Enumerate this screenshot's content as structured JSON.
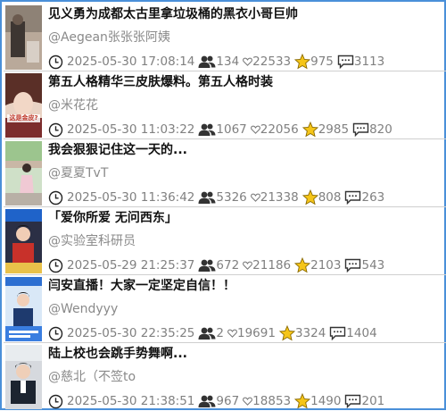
{
  "feed": {
    "items": [
      {
        "title": "见义勇为成都太古里拿垃圾桶的黑衣小哥巨帅",
        "author": "@Aegean张张张阿姨",
        "time": "2025-05-30 17:08:14",
        "viewers": "134",
        "likes": "22533",
        "stars": "975",
        "comments": "3113",
        "thumb_overlay": ""
      },
      {
        "title": "第五人格精华三皮肤爆料。第五人格时装",
        "author": "@米花花",
        "time": "2025-05-30 11:03:22",
        "viewers": "1067",
        "likes": "22056",
        "stars": "2985",
        "comments": "820",
        "thumb_overlay": "这是金皮?"
      },
      {
        "title": "我会狠狠记住这一天的...",
        "author": "@夏夏TvT",
        "time": "2025-05-30 11:36:42",
        "viewers": "5326",
        "likes": "21338",
        "stars": "808",
        "comments": "263",
        "thumb_overlay": ""
      },
      {
        "title": "「爱你所爱 无问西东」",
        "author": "@实验室科研员",
        "time": "2025-05-29 21:25:37",
        "viewers": "672",
        "likes": "21186",
        "stars": "2103",
        "comments": "543",
        "thumb_overlay": ""
      },
      {
        "title": "闫安直播！大家一定坚定自信！！",
        "author": "@Wendyyy",
        "time": "2025-05-30 22:35:25",
        "viewers": "2",
        "likes": "19691",
        "stars": "3324",
        "comments": "1404",
        "thumb_overlay": ""
      },
      {
        "title": "陆上校也会跳手势舞啊...",
        "author": "@慈北（不签to",
        "time": "2025-05-30 21:38:51",
        "viewers": "967",
        "likes": "18853",
        "stars": "1490",
        "comments": "201",
        "thumb_overlay": ""
      }
    ]
  },
  "colors": {
    "frame_border": "#4a90d9",
    "divider": "#cfcfcf",
    "star": "#f5c518",
    "meta_text": "#808080"
  },
  "icons": [
    "clock-icon",
    "viewers-icon",
    "heart-icon",
    "star-icon",
    "comment-icon"
  ]
}
